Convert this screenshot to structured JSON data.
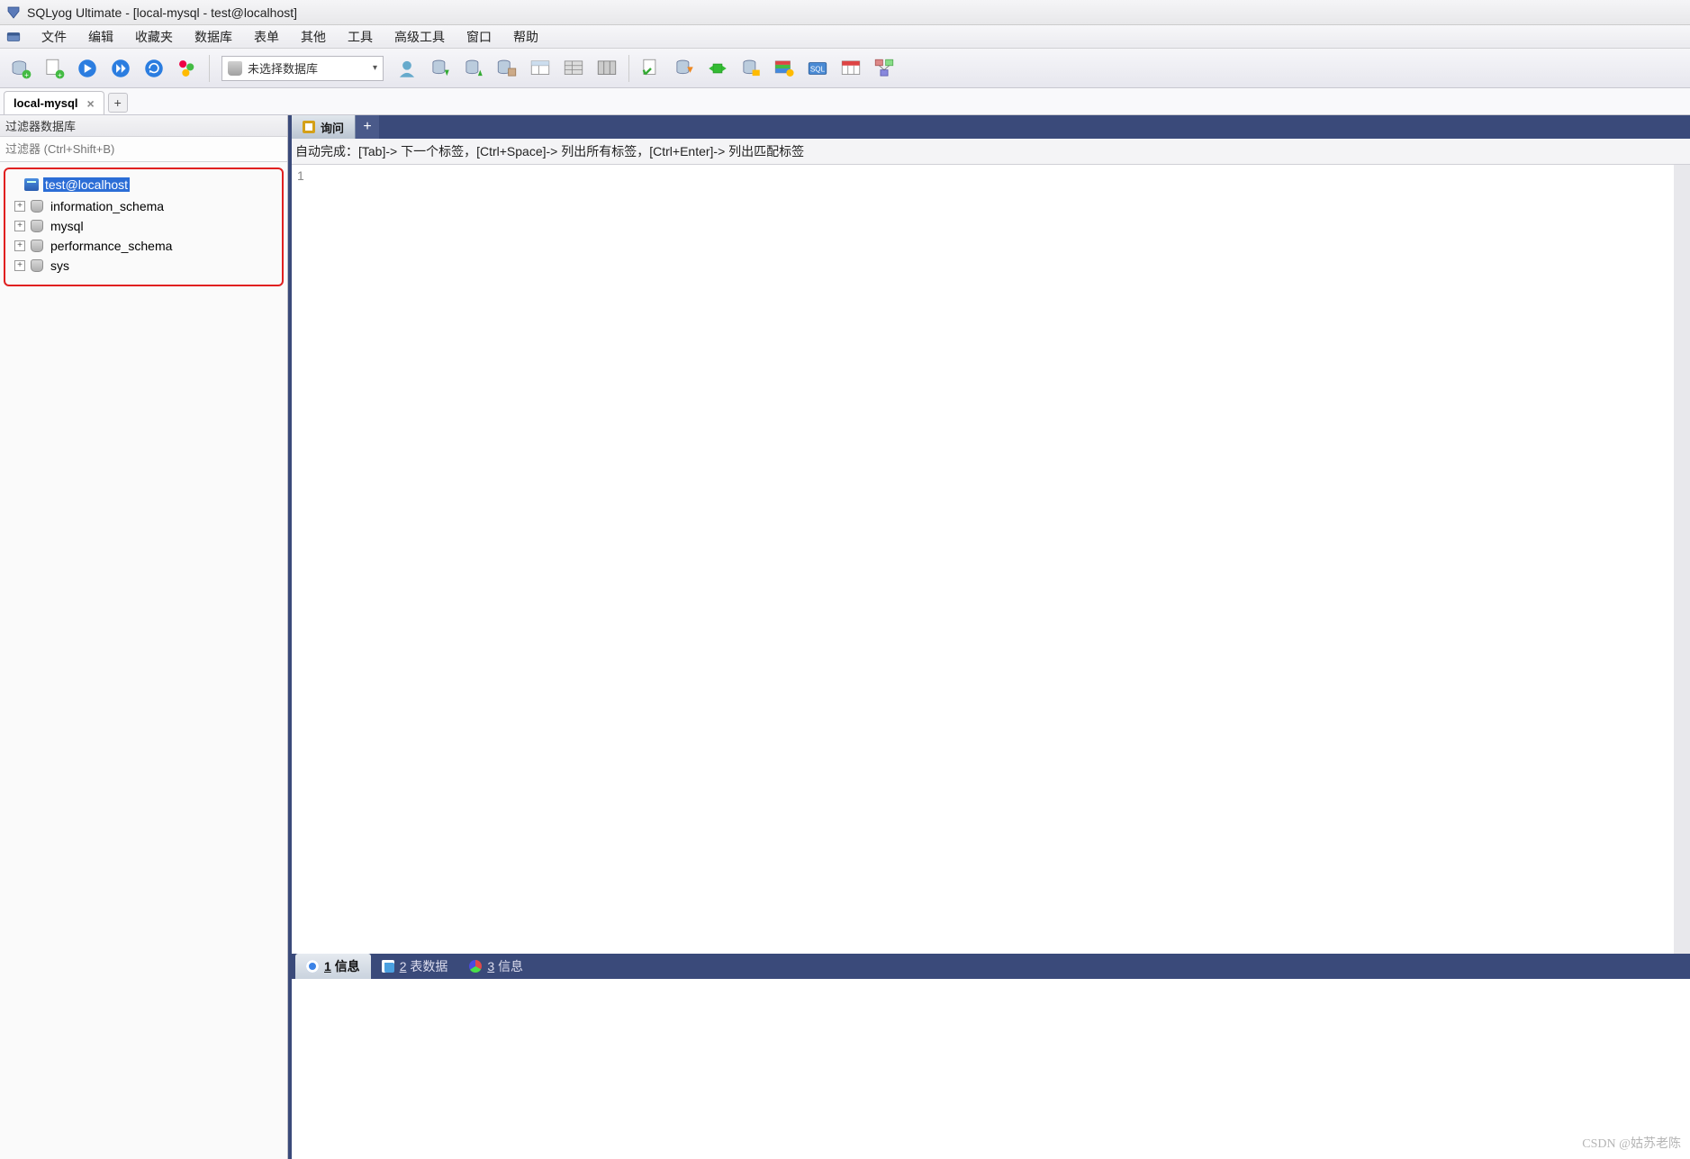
{
  "title": "SQLyog Ultimate - [local-mysql - test@localhost]",
  "menu": {
    "items": [
      "文件",
      "编辑",
      "收藏夹",
      "数据库",
      "表单",
      "其他",
      "工具",
      "高级工具",
      "窗口",
      "帮助"
    ]
  },
  "toolbar": {
    "db_selector_text": "未选择数据库",
    "icons": {
      "new_conn": "new-connection-icon",
      "new_query": "new-query-icon",
      "execute": "execute-icon",
      "execute_all": "execute-all-icon",
      "refresh": "refresh-icon",
      "stop": "stop-icon",
      "user": "user-icon",
      "export_down": "export-down-icon",
      "export_up": "export-up-icon",
      "backup": "backup-icon",
      "table1": "table-tool-icon",
      "table2": "table-tool2-icon",
      "table3": "table-tool3-icon",
      "check": "check-icon",
      "sync": "sync-icon",
      "compare": "compare-icon",
      "schedule": "schedule-icon",
      "grid": "grid-icon",
      "form": "form-icon",
      "pivot": "pivot-icon",
      "schema": "schema-icon"
    }
  },
  "conntab": {
    "label": "local-mysql",
    "close": "×",
    "add": "+"
  },
  "filter": {
    "header": "过滤器数据库",
    "placeholder": "过滤器 (Ctrl+Shift+B)"
  },
  "tree": {
    "root": "test@localhost",
    "children": [
      "information_schema",
      "mysql",
      "performance_schema",
      "sys"
    ]
  },
  "query": {
    "tab_label": "询问",
    "add": "+",
    "hint": "自动完成：[Tab]-> 下一个标签，[Ctrl+Space]-> 列出所有标签，[Ctrl+Enter]-> 列出匹配标签",
    "line_no": "1"
  },
  "results": {
    "tabs": [
      {
        "num": "1",
        "label": "信息",
        "active": true,
        "icon": "info"
      },
      {
        "num": "2",
        "label": "表数据",
        "active": false,
        "icon": "table"
      },
      {
        "num": "3",
        "label": "信息",
        "active": false,
        "icon": "msg"
      }
    ]
  },
  "watermark": "CSDN @姑苏老陈"
}
